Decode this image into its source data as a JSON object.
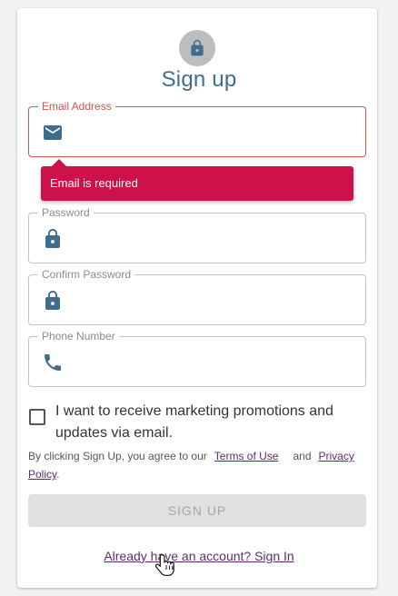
{
  "form": {
    "title": "Sign up",
    "fields": [
      {
        "label": "Email Address",
        "value": "",
        "icon": "email-icon",
        "error": true
      },
      {
        "label": "Password",
        "value": "",
        "icon": "lock-icon",
        "error": false
      },
      {
        "label": "Confirm Password",
        "value": "",
        "icon": "lock-icon",
        "error": false
      },
      {
        "label": "Phone Number",
        "value": "",
        "icon": "phone-icon",
        "error": false
      }
    ],
    "error_message": "Email is required",
    "marketing_checkbox": {
      "label": "I want to receive marketing promotions and updates via email.",
      "checked": false
    },
    "terms": {
      "prefix": "By clicking Sign Up, you agree to our",
      "terms_link": "Terms of Use",
      "and": "and",
      "privacy_link": "Privacy Policy",
      "suffix": "."
    },
    "submit_label": "SIGN UP",
    "signin_link": "Already have an account? Sign In"
  },
  "colors": {
    "accent": "#3f6d8e",
    "error": "#d9534f",
    "tooltip": "#cc1248",
    "link": "#5c2d6e",
    "disabled_button": "#e0e0e0"
  },
  "icons": {
    "avatar": "lock-icon",
    "cursor": "hand-pointer-icon"
  }
}
